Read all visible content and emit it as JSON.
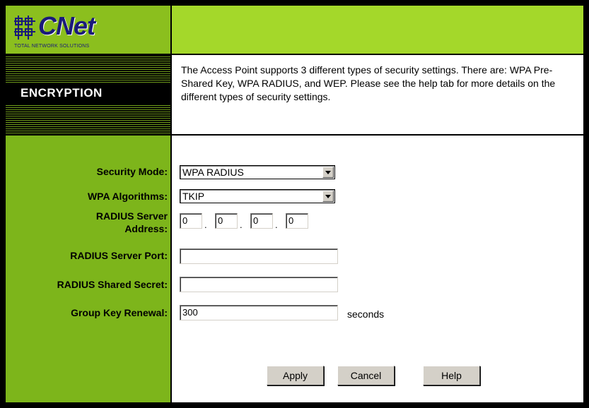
{
  "logo": {
    "text": "CNet",
    "tagline": "TOTAL NETWORK SOLUTIONS"
  },
  "page_title": "ENCRYPTION",
  "description": "The Access Point supports 3 different types of security settings. There are: WPA Pre-Shared Key, WPA RADIUS, and WEP. Please see the help tab for more details on the different types of security settings.",
  "form": {
    "security_mode": {
      "label": "Security Mode:",
      "value": "WPA RADIUS"
    },
    "wpa_algorithms": {
      "label": "WPA Algorithms:",
      "value": "TKIP"
    },
    "radius_server_address": {
      "label_line1": "RADIUS Server",
      "label_line2": "Address:",
      "octets": [
        "0",
        "0",
        "0",
        "0"
      ]
    },
    "radius_server_port": {
      "label": "RADIUS Server Port:",
      "value": ""
    },
    "radius_shared_secret": {
      "label": "RADIUS Shared Secret:",
      "value": ""
    },
    "group_key_renewal": {
      "label": "Group Key Renewal:",
      "value": "300",
      "units": "seconds"
    }
  },
  "buttons": {
    "apply": "Apply",
    "cancel": "Cancel",
    "help": "Help"
  },
  "colors": {
    "header_green": "#a4d82a",
    "sidebar_green": "#7db51b",
    "brand_blue": "#1a1a7a"
  }
}
